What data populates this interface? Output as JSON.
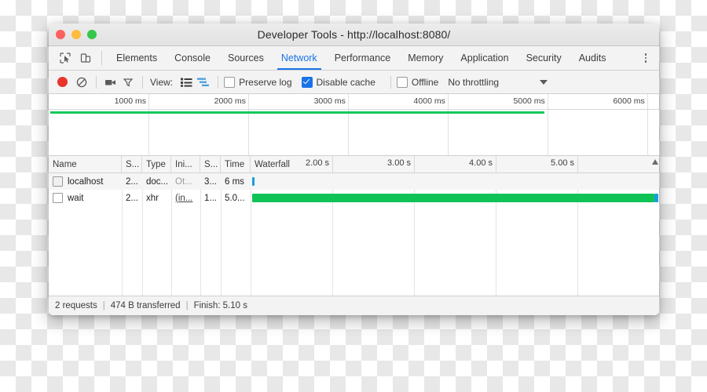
{
  "window": {
    "title": "Developer Tools - http://localhost:8080/",
    "traffic_lights": [
      "close",
      "minimize",
      "zoom"
    ]
  },
  "tabs": {
    "icons": [
      "inspect-cursor-icon",
      "device-toolbar-icon"
    ],
    "items": [
      {
        "label": "Elements",
        "active": false
      },
      {
        "label": "Console",
        "active": false
      },
      {
        "label": "Sources",
        "active": false
      },
      {
        "label": "Network",
        "active": true
      },
      {
        "label": "Performance",
        "active": false
      },
      {
        "label": "Memory",
        "active": false
      },
      {
        "label": "Application",
        "active": false
      },
      {
        "label": "Security",
        "active": false
      },
      {
        "label": "Audits",
        "active": false
      }
    ],
    "overflow_icon": "kebab-menu-icon"
  },
  "toolbar": {
    "record_icon": "record-icon",
    "clear_icon": "clear-icon",
    "camera_icon": "camera-icon",
    "filter_icon": "filter-icon",
    "view_label": "View:",
    "view_list_icon": "list-view-icon",
    "view_waterfall_icon": "waterfall-view-icon",
    "preserve_log": {
      "label": "Preserve log",
      "checked": false
    },
    "disable_cache": {
      "label": "Disable cache",
      "checked": true
    },
    "offline": {
      "label": "Offline",
      "checked": false
    },
    "throttling": {
      "value": "No throttling",
      "caret_icon": "chevron-down-icon"
    },
    "accent_color": "#1a73e8"
  },
  "overview": {
    "ticks": [
      "1000 ms",
      "2000 ms",
      "3000 ms",
      "4000 ms",
      "5000 ms",
      "6000 ms"
    ],
    "green_line_color": "#10c85a",
    "green_line_end_ms": 5100,
    "range_ms": 6300
  },
  "table": {
    "columns": [
      {
        "label": "Name",
        "width": 93
      },
      {
        "label": "S...",
        "width": 26
      },
      {
        "label": "Type",
        "width": 37
      },
      {
        "label": "Ini...",
        "width": 37
      },
      {
        "label": "S...",
        "width": 26
      },
      {
        "label": "Time",
        "width": 38
      }
    ],
    "waterfall_header": "Waterfall",
    "waterfall_ticks": [
      "2.00 s",
      "3.00 s",
      "4.00 s",
      "5.00 s"
    ],
    "rows": [
      {
        "name": "localhost",
        "status": "2...",
        "type": "doc...",
        "initiator": "Ot...",
        "size": "3...",
        "time": "6 ms",
        "bar": {
          "start_pct": 0.4,
          "width_pct": 0.6,
          "color": "blue"
        }
      },
      {
        "name": "wait",
        "status": "2...",
        "type": "xhr",
        "initiator": "(in...",
        "size": "1...",
        "time": "5.0...",
        "bar": {
          "start_pct": 0.4,
          "width_pct": 98.6,
          "color": "green",
          "tail_pct": 1.0,
          "tail_color": "blue"
        }
      }
    ]
  },
  "statusbar": {
    "requests": "2 requests",
    "transferred": "474 B transferred",
    "finish": "Finish: 5.10 s",
    "separator": "|"
  }
}
